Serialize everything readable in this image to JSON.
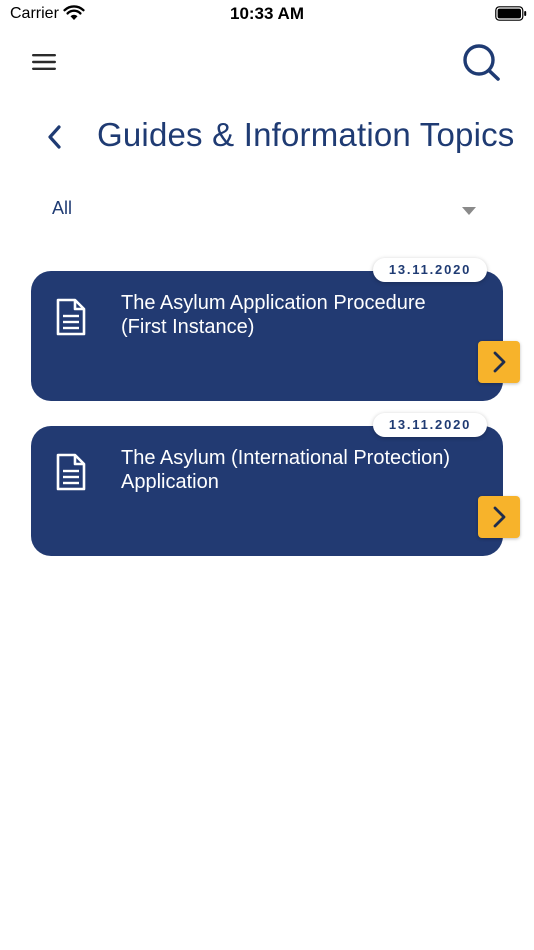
{
  "status_bar": {
    "carrier": "Carrier",
    "time": "10:33 AM"
  },
  "header": {
    "menu_icon": "hamburger-menu-icon",
    "search_icon": "search-icon"
  },
  "page": {
    "title": "Guides & Information Topics",
    "back_icon": "chevron-left-icon"
  },
  "filter": {
    "selected": "All"
  },
  "cards": [
    {
      "date": "13.11.2020",
      "title": "The Asylum Application Procedure (First Instance)",
      "icon": "document-icon"
    },
    {
      "date": "13.11.2020",
      "title": "The Asylum (International Protection) Application",
      "icon": "document-icon"
    }
  ],
  "colors": {
    "primary": "#1f3b73",
    "card_background": "#223a72",
    "accent": "#f7b32b"
  }
}
